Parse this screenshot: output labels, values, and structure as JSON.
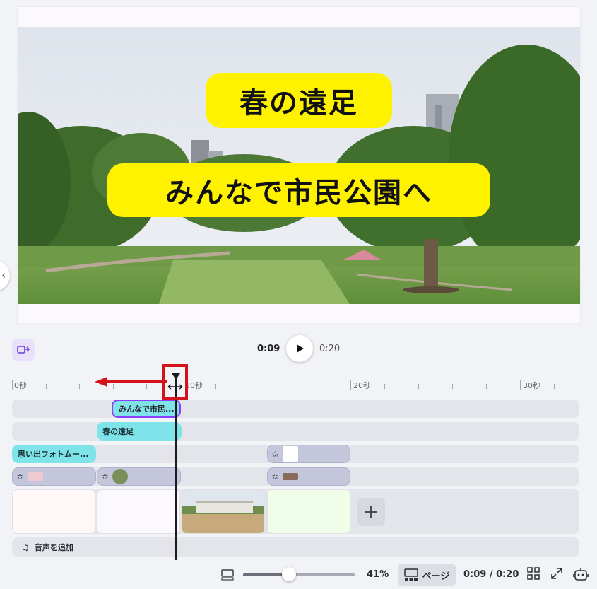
{
  "preview": {
    "caption_title": "春の遠足",
    "caption_subtitle": "みんなで市民公園へ"
  },
  "transport": {
    "current_time": "0:09",
    "total_time": "0:20"
  },
  "ruler": {
    "labels": [
      "0秒",
      "10秒",
      "20秒",
      "30秒"
    ]
  },
  "tracks": {
    "text_clip_1": "みんなで市民...",
    "text_clip_2": "春の遠足",
    "text_clip_3": "思い出フォトムー..."
  },
  "audio": {
    "add_label": "音声を追加"
  },
  "footer": {
    "zoom_percent": "41%",
    "zoom_level": 0.41,
    "page_view_label": "ページ",
    "page_time": "0:09 / 0:20"
  },
  "colors": {
    "accent_purple": "#8b3dff",
    "text_clip": "#7fe3ea",
    "highlight_red": "#d4121b",
    "caption_yellow": "#fff200"
  }
}
